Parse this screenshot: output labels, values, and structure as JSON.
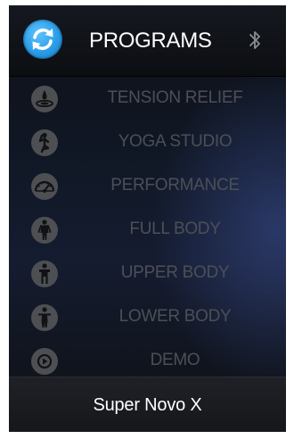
{
  "header": {
    "title": "PROGRAMS",
    "sync_icon": "refresh-icon",
    "bluetooth_icon": "bluetooth-icon"
  },
  "programs": [
    {
      "label": "TENSION RELIEF",
      "icon": "water-drop-icon"
    },
    {
      "label": "YOGA STUDIO",
      "icon": "yoga-pose-icon"
    },
    {
      "label": "PERFORMANCE",
      "icon": "speedometer-icon"
    },
    {
      "label": "FULL BODY",
      "icon": "full-body-icon"
    },
    {
      "label": "UPPER BODY",
      "icon": "upper-body-icon"
    },
    {
      "label": "LOWER BODY",
      "icon": "lower-body-icon"
    },
    {
      "label": "DEMO",
      "icon": "play-icon"
    }
  ],
  "footer": {
    "device_name": "Super Novo X"
  },
  "colors": {
    "accent": "#2a9de8",
    "label_inactive": "#4c4f55",
    "icon_bg": "#4d4f53",
    "header_text": "#ffffff"
  }
}
